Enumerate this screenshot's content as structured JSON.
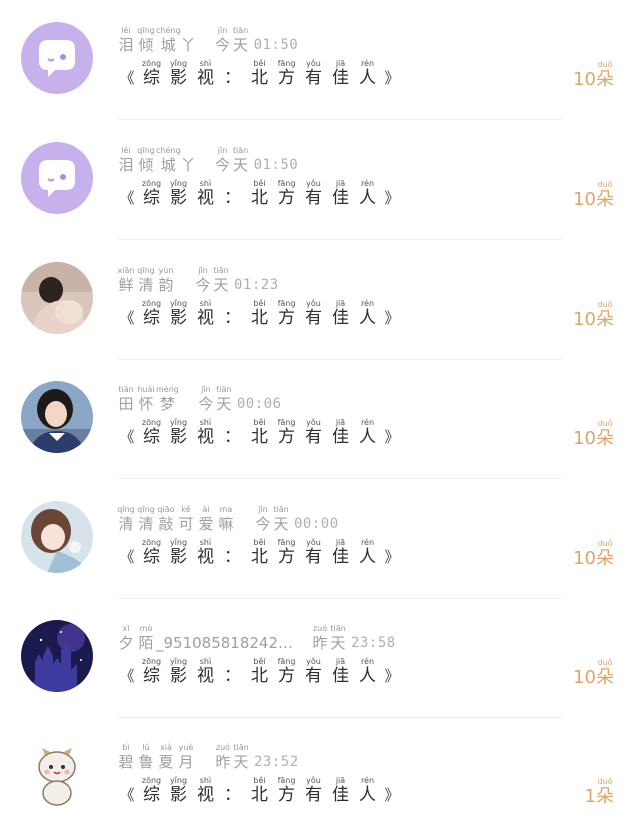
{
  "message": {
    "open": "《",
    "close": "》",
    "chars": [
      {
        "py": "zōng",
        "hz": "综"
      },
      {
        "py": "yǐng",
        "hz": "影"
      },
      {
        "py": "shì",
        "hz": "视"
      },
      {
        "py": "",
        "hz": "："
      },
      {
        "py": "běi",
        "hz": "北"
      },
      {
        "py": "fāng",
        "hz": "方"
      },
      {
        "py": "yǒu",
        "hz": "有"
      },
      {
        "py": "jiā",
        "hz": "佳"
      },
      {
        "py": "rén",
        "hz": "人"
      }
    ]
  },
  "unit": {
    "py": "duǒ",
    "hz": "朵"
  },
  "rows": [
    {
      "name_chars": [
        {
          "py": "lèi",
          "hz": "泪"
        },
        {
          "py": "qīng",
          "hz": "倾"
        },
        {
          "py": "chéng",
          "hz": "城"
        }
      ],
      "name_suffix": "丫",
      "day": [
        {
          "py": "jīn",
          "hz": "今"
        },
        {
          "py": "tiān",
          "hz": "天"
        }
      ],
      "time": "01:50",
      "count": "10",
      "avatar": "purple-chat-icon"
    },
    {
      "name_chars": [
        {
          "py": "lèi",
          "hz": "泪"
        },
        {
          "py": "qīng",
          "hz": "倾"
        },
        {
          "py": "chéng",
          "hz": "城"
        }
      ],
      "name_suffix": "丫",
      "day": [
        {
          "py": "jīn",
          "hz": "今"
        },
        {
          "py": "tiān",
          "hz": "天"
        }
      ],
      "time": "01:50",
      "count": "10",
      "avatar": "purple-chat-icon"
    },
    {
      "name_chars": [
        {
          "py": "xiān",
          "hz": "鲜"
        },
        {
          "py": "qīng",
          "hz": "清"
        },
        {
          "py": "yùn",
          "hz": "韵"
        }
      ],
      "name_suffix": "",
      "day": [
        {
          "py": "jīn",
          "hz": "今"
        },
        {
          "py": "tiān",
          "hz": "天"
        }
      ],
      "time": "01:23",
      "count": "10",
      "avatar": "photo-man"
    },
    {
      "name_chars": [
        {
          "py": "tián",
          "hz": "田"
        },
        {
          "py": "huái",
          "hz": "怀"
        },
        {
          "py": "mèng",
          "hz": "梦"
        }
      ],
      "name_suffix": "",
      "day": [
        {
          "py": "jīn",
          "hz": "今"
        },
        {
          "py": "tiān",
          "hz": "天"
        }
      ],
      "time": "00:06",
      "count": "10",
      "avatar": "photo-girl"
    },
    {
      "name_chars": [
        {
          "py": "qīng",
          "hz": "清"
        },
        {
          "py": "qīng",
          "hz": "清"
        },
        {
          "py": "qiāo",
          "hz": "敲"
        },
        {
          "py": "kě",
          "hz": "可"
        },
        {
          "py": "ài",
          "hz": "爱"
        },
        {
          "py": "ma",
          "hz": "嘛"
        }
      ],
      "name_suffix": "",
      "day": [
        {
          "py": "jīn",
          "hz": "今"
        },
        {
          "py": "tiān",
          "hz": "天"
        }
      ],
      "time": "00:00",
      "count": "10",
      "avatar": "anime-girl"
    },
    {
      "name_chars": [
        {
          "py": "xī",
          "hz": "夕"
        },
        {
          "py": "mò",
          "hz": "陌"
        }
      ],
      "name_suffix": "_951085818242…",
      "day": [
        {
          "py": "zuó",
          "hz": "昨"
        },
        {
          "py": "tiān",
          "hz": "天"
        }
      ],
      "time": "23:58",
      "count": "10",
      "avatar": "night-castle"
    },
    {
      "name_chars": [
        {
          "py": "bì",
          "hz": "碧"
        },
        {
          "py": "lǔ",
          "hz": "鲁"
        },
        {
          "py": "xià",
          "hz": "夏"
        },
        {
          "py": "yuè",
          "hz": "月"
        }
      ],
      "name_suffix": "",
      "day": [
        {
          "py": "zuó",
          "hz": "昨"
        },
        {
          "py": "tiān",
          "hz": "天"
        }
      ],
      "time": "23:52",
      "count": "1",
      "avatar": "cartoon-tiger"
    }
  ]
}
